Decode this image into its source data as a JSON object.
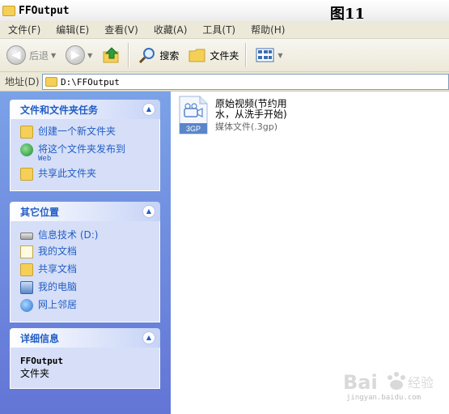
{
  "window": {
    "title": "FFOutput",
    "figure_label": "图11"
  },
  "menu": [
    "文件(F)",
    "编辑(E)",
    "查看(V)",
    "收藏(A)",
    "工具(T)",
    "帮助(H)"
  ],
  "toolbar": {
    "back": "后退",
    "search": "搜索",
    "folders": "文件夹"
  },
  "address": {
    "label": "地址(D)",
    "path": "D:\\FFOutput"
  },
  "tasks_panel": {
    "title": "文件和文件夹任务",
    "items": [
      {
        "label": "创建一个新文件夹",
        "icon": "new-folder-icon"
      },
      {
        "label": "将这个文件夹发布到",
        "sub": "Web",
        "icon": "publish-web-icon"
      },
      {
        "label": "共享此文件夹",
        "icon": "share-folder-icon"
      }
    ]
  },
  "places_panel": {
    "title": "其它位置",
    "items": [
      {
        "label": "信息技术 (D:)",
        "icon": "drive-icon"
      },
      {
        "label": "我的文档",
        "icon": "my-documents-icon"
      },
      {
        "label": "共享文档",
        "icon": "shared-documents-icon"
      },
      {
        "label": "我的电脑",
        "icon": "my-computer-icon"
      },
      {
        "label": "网上邻居",
        "icon": "network-places-icon"
      }
    ]
  },
  "details_panel": {
    "title": "详细信息",
    "name": "FFOutput",
    "type": "文件夹"
  },
  "file": {
    "name": "原始视频(节约用水，从洗手开始)",
    "type": "媒体文件(.3gp)",
    "badge": "3GP"
  },
  "watermark": {
    "text": "jingyan.baidu.com"
  }
}
